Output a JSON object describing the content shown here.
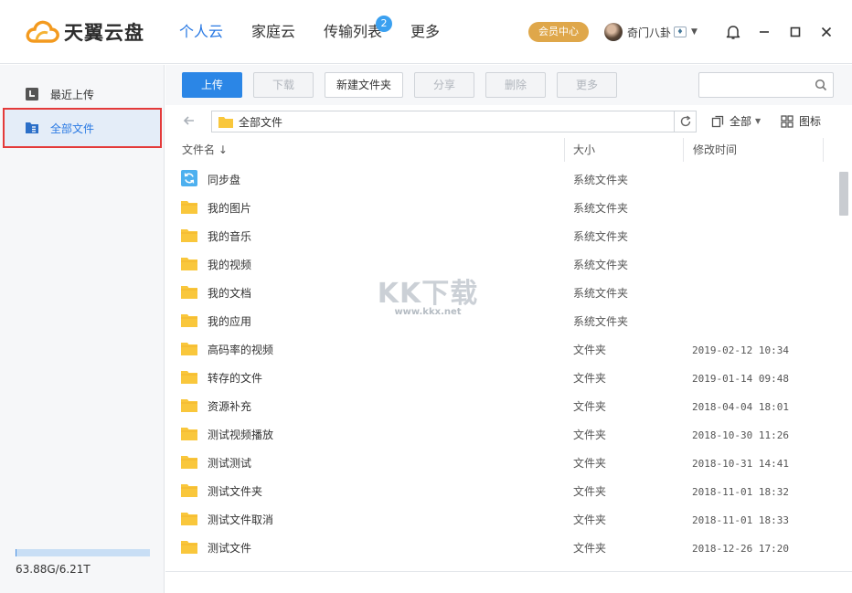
{
  "app": {
    "name": "天翼云盘"
  },
  "nav": {
    "items": [
      {
        "label": "个人云",
        "active": true
      },
      {
        "label": "家庭云",
        "active": false
      },
      {
        "label": "传输列表",
        "active": false,
        "badge": "2"
      },
      {
        "label": "更多",
        "active": false
      }
    ]
  },
  "header": {
    "vip_label": "会员中心",
    "user_name": "奇门八卦",
    "user_vip_icon": "vip-badge-icon"
  },
  "sidebar": {
    "items": [
      {
        "label": "最近上传",
        "icon": "recent-icon",
        "selected": false
      },
      {
        "label": "全部文件",
        "icon": "file-icon",
        "selected": true
      }
    ],
    "quota_text": "63.88G/6.21T",
    "quota_fraction": 0.01
  },
  "toolbar": {
    "upload": "上传",
    "download": "下载",
    "new_folder": "新建文件夹",
    "share": "分享",
    "delete": "删除",
    "more": "更多",
    "search_placeholder": ""
  },
  "pathbar": {
    "path": "全部文件",
    "filter": "全部",
    "view": "图标"
  },
  "columns": {
    "name": "文件名 ↓",
    "size": "大小",
    "modified": "修改时间"
  },
  "files": [
    {
      "name": "同步盘",
      "type": "系统文件夹",
      "date": "",
      "icon": "sync-folder-icon"
    },
    {
      "name": "我的图片",
      "type": "系统文件夹",
      "date": "",
      "icon": "folder-icon"
    },
    {
      "name": "我的音乐",
      "type": "系统文件夹",
      "date": "",
      "icon": "folder-icon"
    },
    {
      "name": "我的视频",
      "type": "系统文件夹",
      "date": "",
      "icon": "folder-icon"
    },
    {
      "name": "我的文档",
      "type": "系统文件夹",
      "date": "",
      "icon": "folder-icon"
    },
    {
      "name": "我的应用",
      "type": "系统文件夹",
      "date": "",
      "icon": "folder-icon"
    },
    {
      "name": "高码率的视频",
      "type": "文件夹",
      "date": "2019-02-12 10:34",
      "icon": "folder-icon"
    },
    {
      "name": "转存的文件",
      "type": "文件夹",
      "date": "2019-01-14 09:48",
      "icon": "folder-icon"
    },
    {
      "name": "资源补充",
      "type": "文件夹",
      "date": "2018-04-04 18:01",
      "icon": "folder-icon"
    },
    {
      "name": "测试视频播放",
      "type": "文件夹",
      "date": "2018-10-30 11:26",
      "icon": "folder-icon"
    },
    {
      "name": "测试测试",
      "type": "文件夹",
      "date": "2018-10-31 14:41",
      "icon": "folder-icon"
    },
    {
      "name": "测试文件夹",
      "type": "文件夹",
      "date": "2018-11-01 18:32",
      "icon": "folder-icon"
    },
    {
      "name": "测试文件取消",
      "type": "文件夹",
      "date": "2018-11-01 18:33",
      "icon": "folder-icon"
    },
    {
      "name": "测试文件",
      "type": "文件夹",
      "date": "2018-12-26 17:20",
      "icon": "folder-icon"
    }
  ],
  "watermark": {
    "big": "KK下载",
    "small": "www.kkx.net"
  },
  "colors": {
    "accent": "#2979e3",
    "primary_button": "#2b86e6",
    "vip": "#dfa74a",
    "folder": "#f9c73c",
    "selection_border": "#e43a3a"
  }
}
